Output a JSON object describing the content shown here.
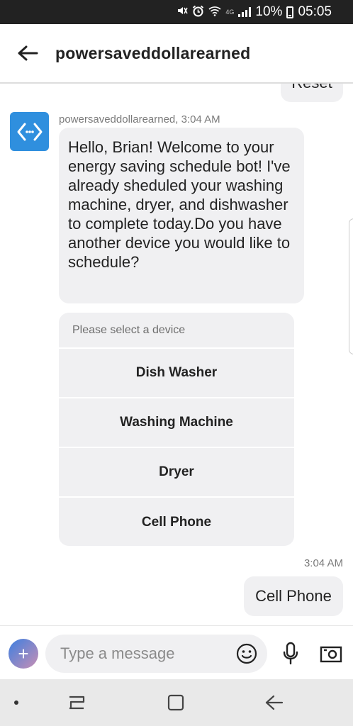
{
  "status_bar": {
    "network": "4G",
    "battery": "10%",
    "time": "05:05",
    "icons": [
      "mute-icon",
      "alarm-icon",
      "wifi-icon",
      "signal-icon",
      "battery-icon"
    ]
  },
  "header": {
    "back_icon": "arrow-left-icon",
    "title": "powersaveddollarearned"
  },
  "chat": {
    "previous_user_message": "Reset",
    "bot_message": {
      "sender_line": "powersaveddollarearned, 3:04 AM",
      "text": "Hello, Brian! Welcome to your energy saving schedule bot! I've already sheduled your washing machine, dryer, and dishwasher to complete today.Do you have another device you would like to schedule?"
    },
    "device_selector": {
      "prompt": "Please select a device",
      "options": [
        "Dish Washer",
        "Washing Machine",
        "Dryer",
        "Cell Phone"
      ]
    },
    "user_message": {
      "timestamp": "3:04 AM",
      "text": "Cell Phone"
    }
  },
  "input_bar": {
    "placeholder": "Type a message",
    "icons": [
      "plus-icon",
      "emoji-icon",
      "microphone-icon",
      "camera-icon"
    ]
  },
  "nav_bar": {
    "icons": [
      "dot-icon",
      "recent-apps-icon",
      "home-icon",
      "back-icon"
    ]
  },
  "colors": {
    "accent": "#2f8fde",
    "bubble": "#f0f0f2",
    "status_bar": "#222222",
    "nav_bar": "#e9e9e9"
  }
}
